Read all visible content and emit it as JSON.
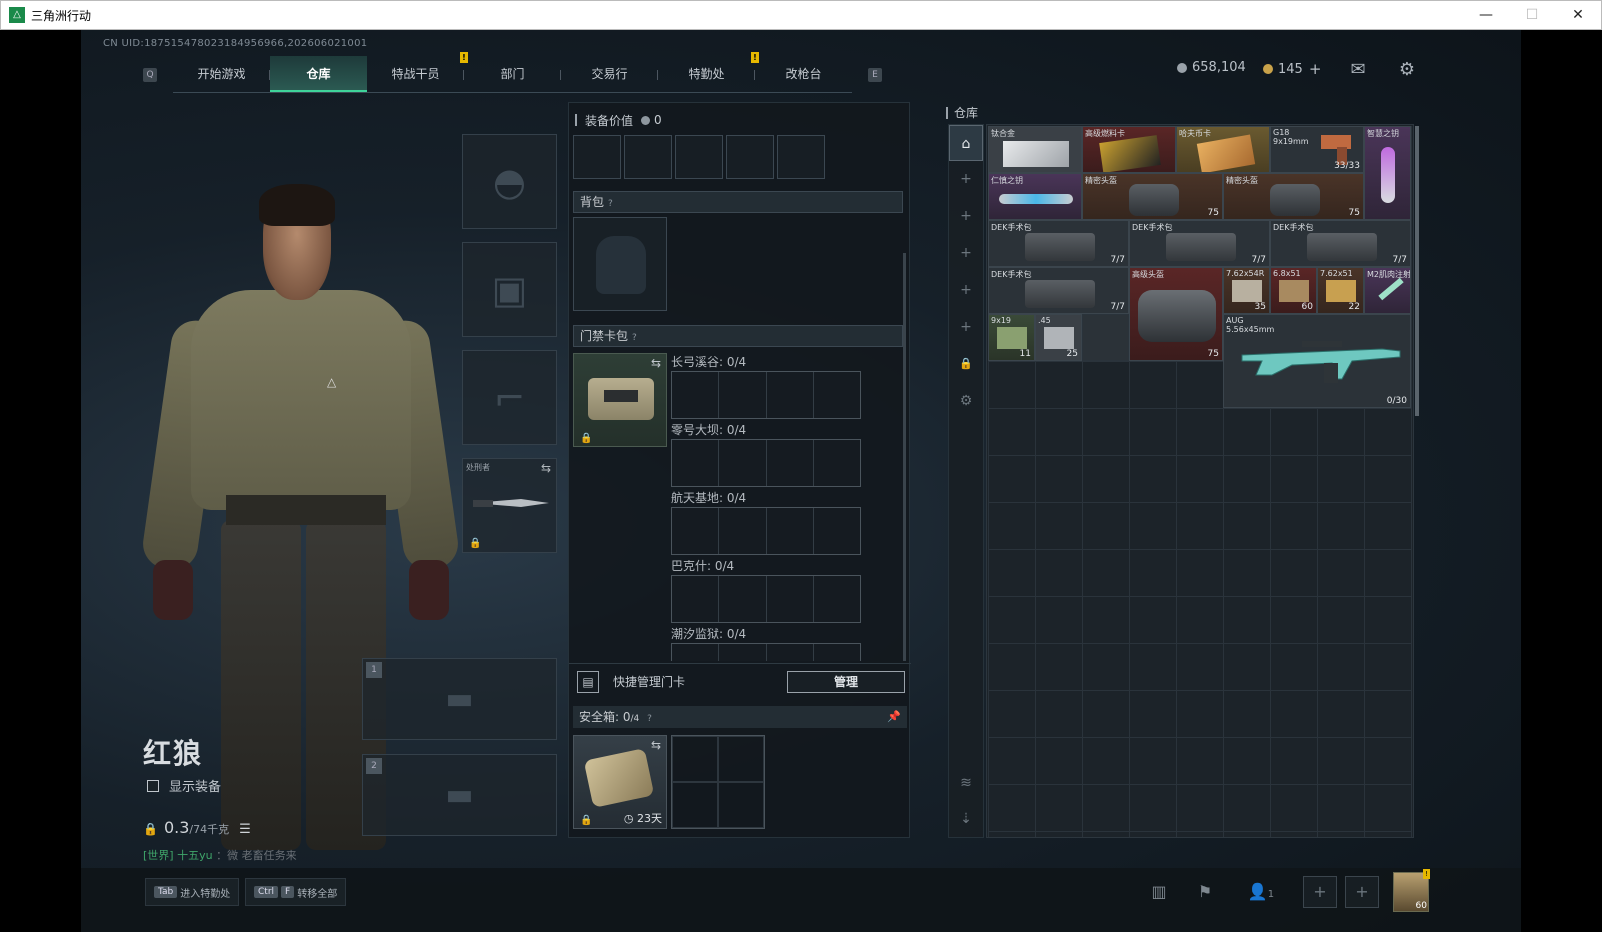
{
  "window": {
    "title": "三角洲行动",
    "minimize": "—",
    "maximize": "☐",
    "close": "✕"
  },
  "uid": "CN UID:187515478023184956966,202606021001",
  "nav": {
    "left_key": "Q",
    "right_key": "E",
    "tabs": [
      {
        "label": "开始游戏",
        "active": false,
        "alert": false
      },
      {
        "label": "仓库",
        "active": true,
        "alert": false
      },
      {
        "label": "特战干员",
        "active": false,
        "alert": true
      },
      {
        "label": "部门",
        "active": false,
        "alert": false
      },
      {
        "label": "交易行",
        "active": false,
        "alert": false
      },
      {
        "label": "特勤处",
        "active": false,
        "alert": true
      },
      {
        "label": "改枪台",
        "active": false,
        "alert": false
      }
    ],
    "alert_mark": "!"
  },
  "currency": {
    "hafu_coin": "658,104",
    "delta_coin": "145",
    "add_symbol": "+"
  },
  "icons": {
    "mail": "mail-icon",
    "settings": "gear-icon"
  },
  "operator": {
    "name": "红狼",
    "show_equipment_label": "显示装备",
    "weight_value": "0.3",
    "weight_max": "/74千克",
    "list_icon": "☰"
  },
  "chat": {
    "channel": "[世界]",
    "user": "十五yu",
    "message": "：微 老畜任务来"
  },
  "equipment": {
    "melee_label": "处刑者",
    "weapon_slot_1": "1",
    "weapon_slot_2": "2"
  },
  "middle": {
    "equip_value_label": "装备价值",
    "equip_value": "0",
    "backpack_label": "背包",
    "keycard_label": "门禁卡包",
    "help_mark": "?",
    "maps": [
      {
        "label": "长弓溪谷: 0/4"
      },
      {
        "label": "零号大坝: 0/4"
      },
      {
        "label": "航天基地: 0/4"
      },
      {
        "label": "巴克什: 0/4"
      },
      {
        "label": "潮汐监狱: 0/4"
      }
    ],
    "quick_manage_label": "快捷管理门卡",
    "manage_button": "管理",
    "safebox_label": "安全箱:",
    "safebox_count": "0",
    "safebox_max": "/4",
    "safebox_time": "23天"
  },
  "warehouse": {
    "label": "仓库",
    "items": [
      {
        "name": "钛合金",
        "count": "",
        "sub": ""
      },
      {
        "name": "高级燃料卡",
        "count": "",
        "sub": ""
      },
      {
        "name": "哈夫币卡",
        "count": "",
        "sub": ""
      },
      {
        "name": "G18",
        "sub": "9x19mm",
        "count": "33/33"
      },
      {
        "name": "智慧之钥",
        "count": "",
        "sub": ""
      },
      {
        "name": "仁慎之钥",
        "count": "",
        "sub": ""
      },
      {
        "name": "精密头盔",
        "count": "75",
        "sub": ""
      },
      {
        "name": "精密头盔",
        "count": "75",
        "sub": ""
      },
      {
        "name": "DEK手术包",
        "count": "7/7",
        "sub": ""
      },
      {
        "name": "DEK手术包",
        "count": "7/7",
        "sub": ""
      },
      {
        "name": "DEK手术包",
        "count": "7/7",
        "sub": ""
      },
      {
        "name": "DEK手术包",
        "count": "7/7",
        "sub": ""
      },
      {
        "name": "高级头盔",
        "count": "75",
        "sub": ""
      },
      {
        "name": "7.62x54R",
        "count": "35",
        "sub": ""
      },
      {
        "name": "6.8x51",
        "count": "60",
        "sub": ""
      },
      {
        "name": "7.62x51",
        "count": "22",
        "sub": ""
      },
      {
        "name": "M2肌肉注射",
        "count": "",
        "sub": ""
      },
      {
        "name": "9x19",
        "count": "11",
        "sub": ""
      },
      {
        "name": ".45",
        "count": "25",
        "sub": ""
      },
      {
        "name": "AUG",
        "sub": "5.56x45mm",
        "count": "0/30"
      }
    ],
    "side_tabs": [
      "⌂",
      "+",
      "+",
      "+",
      "+",
      "+",
      "🔒",
      "⚙",
      "≋",
      "⇣"
    ]
  },
  "bottom": {
    "hint1_key": "Tab",
    "hint1_text": "进入特勤处",
    "hint2_key1": "Ctrl",
    "hint2_key2": "F",
    "hint2_text": "转移全部",
    "party_count": "1",
    "party_add": "+",
    "avatar_level": "60"
  }
}
